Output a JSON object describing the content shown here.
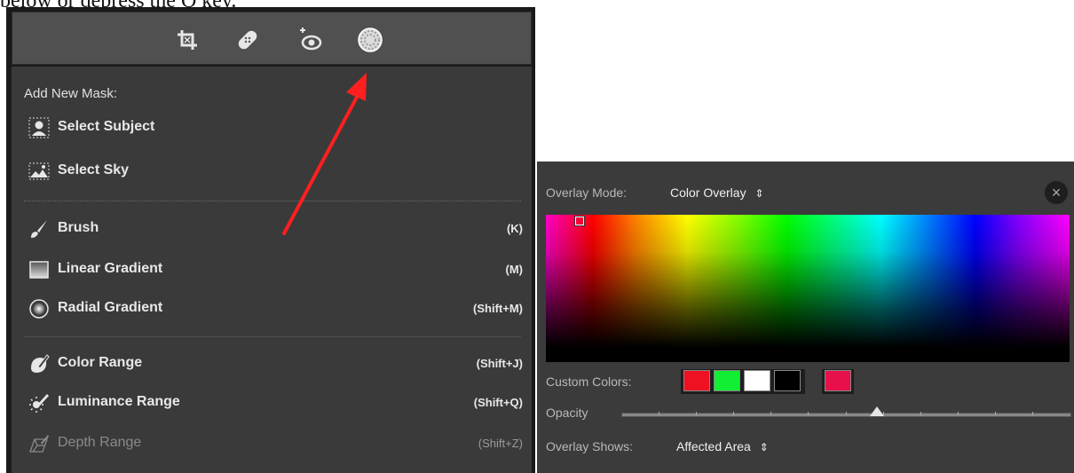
{
  "page_text": "below or depress the O key.",
  "toolbar": {
    "icons": [
      "crop-icon",
      "healing-icon",
      "red-eye-icon",
      "masking-icon"
    ]
  },
  "mask_menu": {
    "header": "Add New Mask:",
    "items": [
      {
        "label": "Select Subject",
        "shortcut": "",
        "icon": "person-select-icon"
      },
      {
        "label": "Select Sky",
        "shortcut": "",
        "icon": "sky-select-icon"
      },
      {
        "label": "Brush",
        "shortcut": "(K)",
        "icon": "brush-icon"
      },
      {
        "label": "Linear Gradient",
        "shortcut": "(M)",
        "icon": "linear-gradient-icon"
      },
      {
        "label": "Radial Gradient",
        "shortcut": "(Shift+M)",
        "icon": "radial-gradient-icon"
      },
      {
        "label": "Color Range",
        "shortcut": "(Shift+J)",
        "icon": "color-range-icon"
      },
      {
        "label": "Luminance Range",
        "shortcut": "(Shift+Q)",
        "icon": "luminance-range-icon"
      },
      {
        "label": "Depth Range",
        "shortcut": "(Shift+Z)",
        "icon": "depth-range-icon",
        "disabled": true
      }
    ]
  },
  "overlay": {
    "mode_label": "Overlay Mode:",
    "mode_value": "Color Overlay",
    "close_glyph": "×",
    "custom_colors_label": "Custom Colors:",
    "custom_colors": [
      "#ee1122",
      "#11ee33",
      "#ffffff",
      "#000000",
      "#e8104a"
    ],
    "opacity_label": "Opacity",
    "opacity_value": 0.57,
    "shows_label": "Overlay Shows:",
    "shows_value": "Affected Area"
  },
  "colors": {
    "arrow": "#ff1f1f",
    "panel_bg": "#3a3a3a",
    "toolbar_bg": "#505050"
  }
}
